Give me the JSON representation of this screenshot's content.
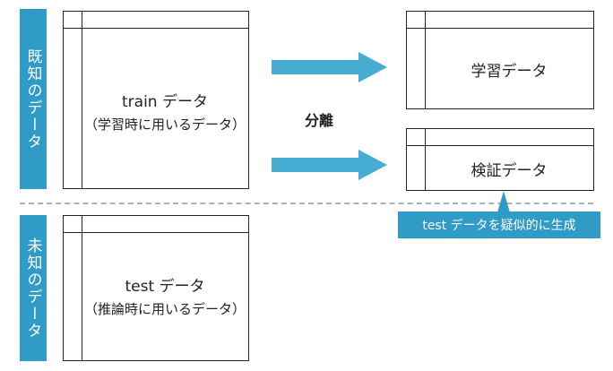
{
  "labels": {
    "known": "既知のデータ",
    "unknown": "未知のデータ"
  },
  "train_box": {
    "title": "train データ",
    "subtitle": "（学習時に用いるデータ）"
  },
  "test_box": {
    "title": "test データ",
    "subtitle": "（推論時に用いるデータ）"
  },
  "split_label": "分離",
  "learning_box": {
    "title": "学習データ"
  },
  "validation_box": {
    "title": "検証データ"
  },
  "callout": "test データを疑似的に生成",
  "colors": {
    "accent": "#2f9bc6",
    "arrow": "#47acd2",
    "divider": "#b0b0b0",
    "line": "#222222"
  }
}
